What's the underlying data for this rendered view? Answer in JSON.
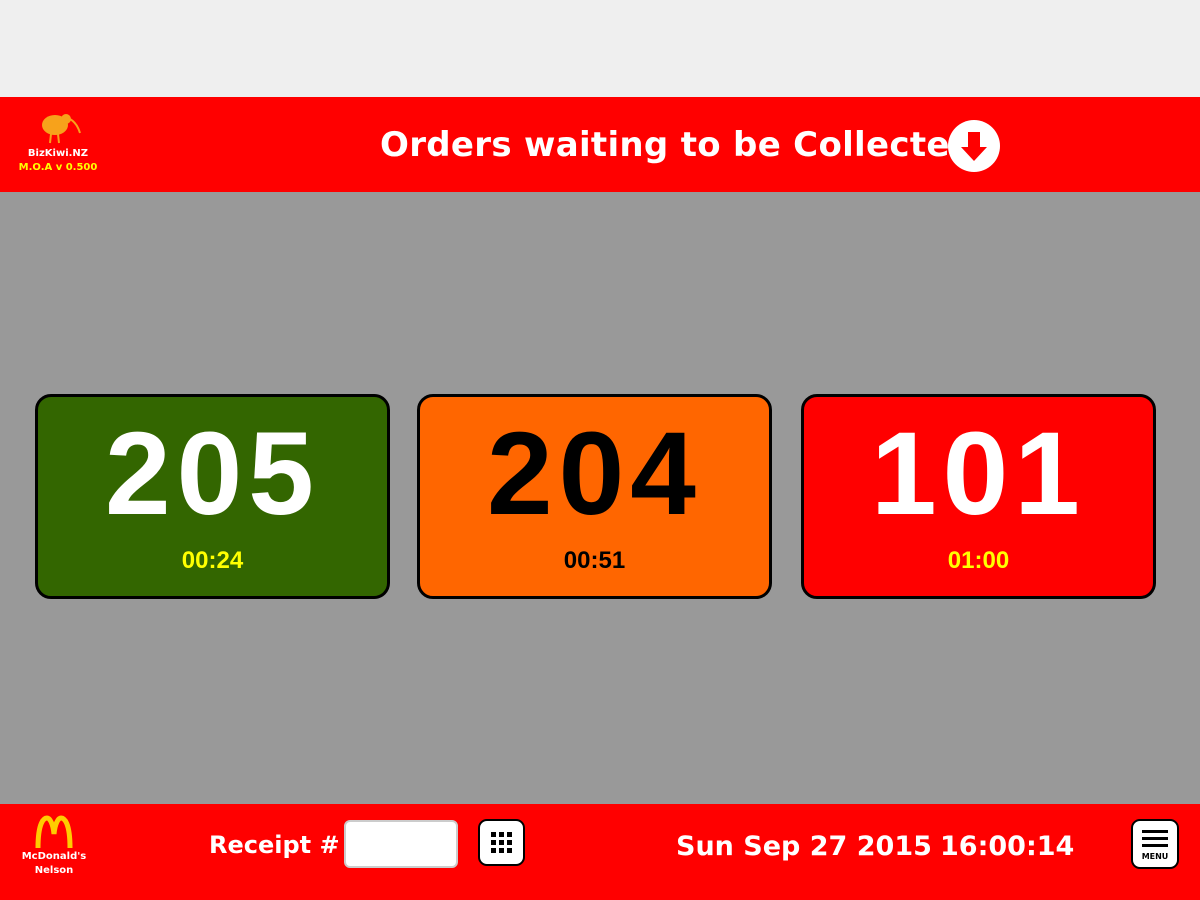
{
  "header": {
    "brand_name": "BizKiwi.NZ",
    "brand_version": "M.O.A v 0.500",
    "title": "Orders waiting to be Collected",
    "arrow_icon": "arrow-down-circle-icon",
    "background": "#ff0000"
  },
  "orders": [
    {
      "number": "205",
      "elapsed": "00:24",
      "bg": "#336600",
      "number_color": "#ffffff",
      "time_color": "#ffff00"
    },
    {
      "number": "204",
      "elapsed": "00:51",
      "bg": "#ff6600",
      "number_color": "#000000",
      "time_color": "#000000"
    },
    {
      "number": "101",
      "elapsed": "01:00",
      "bg": "#ff0000",
      "number_color": "#ffffff",
      "time_color": "#ffff00"
    }
  ],
  "footer": {
    "store_line1": "McDonald's",
    "store_line2": "Nelson",
    "receipt_label": "Receipt #",
    "receipt_value": "",
    "keypad_icon": "keypad-grid-icon",
    "date": "Sun Sep 27 2015",
    "time": "16:00:14",
    "menu_label": "MENU",
    "menu_icon": "hamburger-menu-icon"
  },
  "colors": {
    "bar_red": "#ff0000",
    "content_gray": "#999999",
    "top_blank": "#efefef"
  }
}
